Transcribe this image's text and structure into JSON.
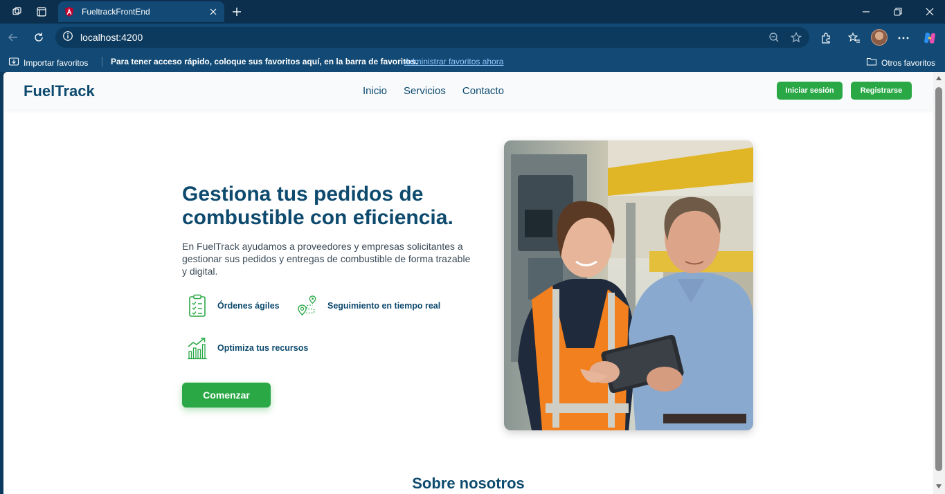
{
  "browser": {
    "tab_title": "FueltrackFrontEnd",
    "url": "localhost:4200",
    "favorites_bar": {
      "import_label": "Importar favoritos",
      "message": "Para tener acceso rápido, coloque sus favoritos aquí, en la barra de favoritos.",
      "manage_link": "Administrar favoritos ahora",
      "other_label": "Otros favoritos"
    }
  },
  "site": {
    "brand": "FuelTrack",
    "nav": [
      "Inicio",
      "Servicios",
      "Contacto"
    ],
    "login_label": "Iniciar sesión",
    "register_label": "Registrarse"
  },
  "hero": {
    "title_line1": "Gestiona tus pedidos de",
    "title_line2": "combustible con eficiencia.",
    "description": "En FuelTrack ayudamos a proveedores y empresas solicitantes a gestionar sus pedidos y entregas de combustible de forma trazable y digital.",
    "features": [
      {
        "label": "Órdenes ágiles",
        "icon": "clipboard-check-icon"
      },
      {
        "label": "Seguimiento en tiempo real",
        "icon": "route-pin-icon"
      },
      {
        "label": "Optimiza tus recursos",
        "icon": "growth-chart-icon"
      }
    ],
    "cta_label": "Comenzar"
  },
  "about": {
    "title": "Sobre nosotros"
  },
  "colors": {
    "brand_blue": "#0d4a6e",
    "accent_green": "#2aa846",
    "chrome_dark": "#0b2f4d",
    "chrome": "#124a75"
  }
}
